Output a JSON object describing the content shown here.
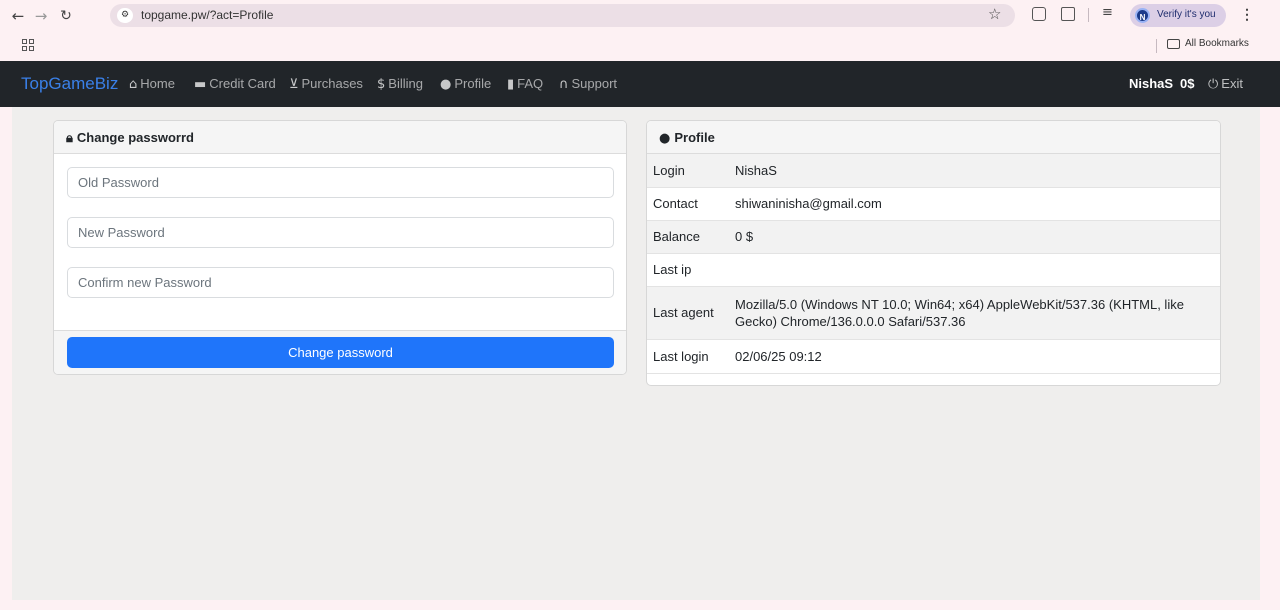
{
  "browser": {
    "url": "topgame.pw/?act=Profile",
    "verify_label": "Verify it's you",
    "profile_initial": "N",
    "all_bookmarks": "All Bookmarks"
  },
  "navbar": {
    "brand": "TopGameBiz",
    "items": [
      {
        "icon": "home-icon",
        "label": "Home"
      },
      {
        "icon": "credit-card-icon",
        "label": "Credit Card"
      },
      {
        "icon": "cart-icon",
        "label": "Purchases"
      },
      {
        "icon": "dollar-icon",
        "label": "Billing"
      },
      {
        "icon": "user-icon",
        "label": "Profile"
      },
      {
        "icon": "book-icon",
        "label": "FAQ"
      },
      {
        "icon": "headphones-icon",
        "label": "Support"
      }
    ],
    "username": "NishaS",
    "balance": "0$",
    "exit_label": "Exit"
  },
  "change_password": {
    "title": "Change passworrd",
    "old_placeholder": "Old Password",
    "new_placeholder": "New Password",
    "confirm_placeholder": "Confirm new Password",
    "button_label": "Change password"
  },
  "profile": {
    "title": "Profile",
    "rows": [
      {
        "key": "Login",
        "value": "NishaS"
      },
      {
        "key": "Contact",
        "value": "shiwaninisha@gmail.com"
      },
      {
        "key": "Balance",
        "value": "0 $"
      },
      {
        "key": "Last ip",
        "value": ""
      },
      {
        "key": "Last agent",
        "value": "Mozilla/5.0 (Windows NT 10.0; Win64; x64) AppleWebKit/537.36 (KHTML, like Gecko) Chrome/136.0.0.0 Safari/537.36"
      },
      {
        "key": "Last login",
        "value": "02/06/25 09:12"
      }
    ]
  },
  "colors": {
    "navbar_bg": "#212529",
    "brand": "#3a80e8",
    "primary_button": "#1f75fa",
    "page_bg": "#efeeed"
  }
}
